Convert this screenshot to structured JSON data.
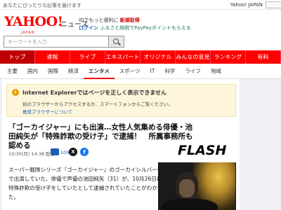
{
  "topbar": {
    "left_text": "あなたにぴったりな記事を届けます",
    "right_link": "Yahoo! JAPAN"
  },
  "header": {
    "logo": "YAHOO!",
    "logo_sub": "JAPAN",
    "service": "ニュース",
    "login_line1_prefix": "IDでもっと便利に",
    "login_line1_link": "新規取得",
    "login_line2_link": "ログイン",
    "login_line2_text": "ふるさと納税でPayPayポイントもらえる"
  },
  "search": {
    "placeholder": "キーワードを入力"
  },
  "main_nav": [
    "トップ",
    "速報",
    "ライブ",
    "エキスパート",
    "オリジナル",
    "みんなの意見",
    "ランキング",
    "有料"
  ],
  "sub_nav": {
    "items": [
      "主要",
      "国内",
      "国際",
      "経済",
      "エンタメ",
      "スポーツ",
      "IT",
      "科学",
      "ライフ",
      "地域"
    ],
    "active": "エンタメ"
  },
  "notice": {
    "title": "Internet Explorerではページを正しく表示できません",
    "body": "別のブラウザーからアクセスするか、スマートフォンからご覧ください。",
    "link": "推奨ブラウザーについて"
  },
  "article": {
    "title": "「ゴーカイジャー」にも出演…女性人気集める俳優・池田純矢が「特殊詐欺の受け子」で逮捕！　所属事務所も認める",
    "date": "10/30(月) 14:38 配信",
    "comments": "109",
    "source_logo": "FLASH",
    "body": "スーパー戦隊シリーズ『ゴーカイジャー』のゴーカイシルバー役で出演していた、俳優で声優の池田純矢（31）が、10月26日に特殊詐欺の受け子をしていたとして逮捕されていたことがわかった。"
  },
  "colors": {
    "brand_red": "#ff0000",
    "nav_active": "#c00000",
    "notice_bg": "#fdf6dc",
    "link_blue": "#1b5fb4"
  },
  "icons": [
    "search-icon",
    "warning-icon",
    "comment-icon",
    "x-share-icon",
    "facebook-share-icon"
  ]
}
